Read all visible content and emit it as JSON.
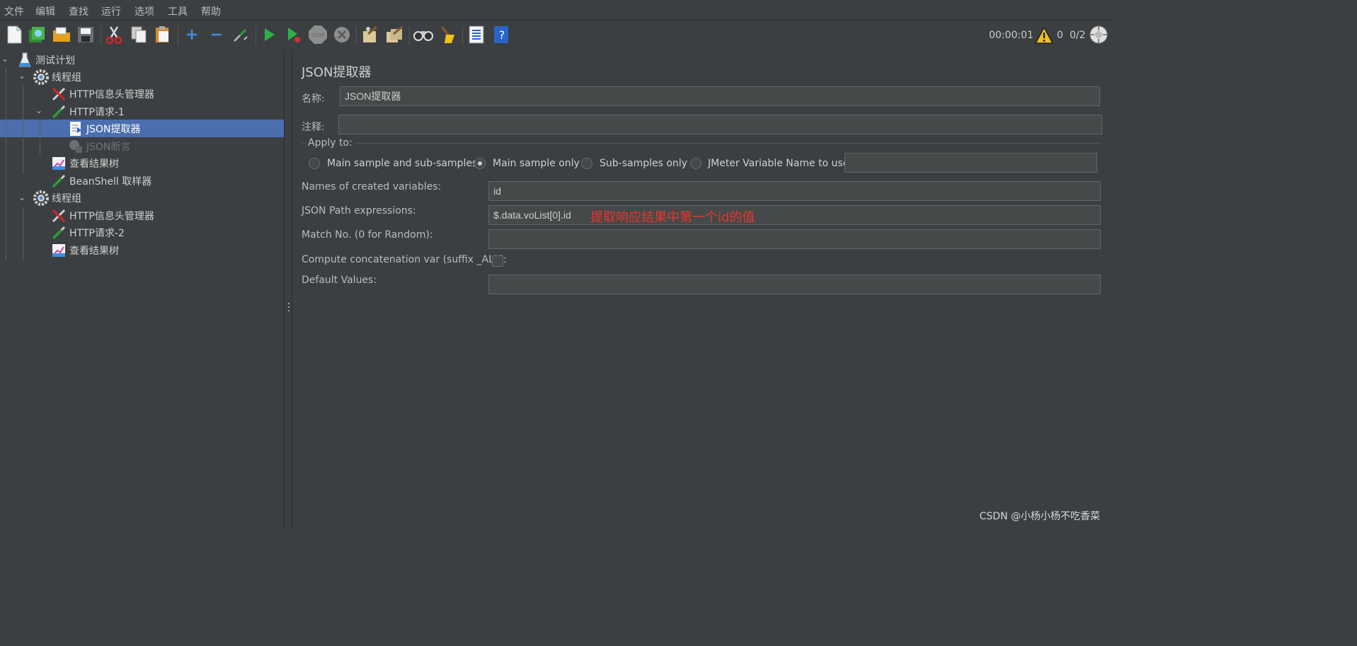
{
  "menu": [
    "文件",
    "编辑",
    "查找",
    "运行",
    "选项",
    "工具",
    "帮助"
  ],
  "toolbar_icons": [
    "new-icon",
    "templates-icon",
    "open-icon",
    "save-icon",
    "cut-icon",
    "copy-icon",
    "paste-icon",
    "expand-icon",
    "collapse-icon",
    "toggle-icon",
    "start-icon",
    "start-no-pause-icon",
    "stop-icon",
    "shutdown-icon",
    "clear-icon",
    "clear-all-icon",
    "search-icon",
    "reset-search-icon",
    "function-helper-icon",
    "help-icon"
  ],
  "status": {
    "elapsed": "00:00:01",
    "warnings": "0",
    "threads": "0/2"
  },
  "tree": [
    {
      "label": "测试计划"
    },
    {
      "label": "线程组"
    },
    {
      "label": "HTTP信息头管理器"
    },
    {
      "label": "HTTP请求-1"
    },
    {
      "label": "JSON提取器"
    },
    {
      "label": "JSON断言"
    },
    {
      "label": "查看结果树"
    },
    {
      "label": "BeanShell 取样器"
    },
    {
      "label": "线程组"
    },
    {
      "label": "HTTP信息头管理器"
    },
    {
      "label": "HTTP请求-2"
    },
    {
      "label": "查看结果树"
    }
  ],
  "panel": {
    "title": "JSON提取器",
    "name_label": "名称:",
    "name_value": "JSON提取器",
    "comment_label": "注释:",
    "comment_value": "",
    "apply_to_label": "Apply to:",
    "apply_options": [
      "Main sample and sub-samples",
      "Main sample only",
      "Sub-samples only",
      "JMeter Variable Name to use"
    ],
    "apply_selected": 1,
    "jmeter_var_value": "",
    "vars_label": "Names of created variables:",
    "vars_value": "id",
    "path_label": "JSON Path expressions:",
    "path_value": "$.data.voList[0].id",
    "match_label": "Match No. (0 for Random):",
    "match_value": "",
    "concat_label": "Compute concatenation var (suffix _ALL):",
    "concat_checked": false,
    "default_label": "Default Values:",
    "default_value": ""
  },
  "annotation": "提取响应结果中第一个id的值",
  "watermark": "CSDN @小杨小杨不吃香菜",
  "colors": {
    "background": "#3c3f41",
    "selection": "#4b6eaf",
    "annotation": "#e8362b"
  }
}
